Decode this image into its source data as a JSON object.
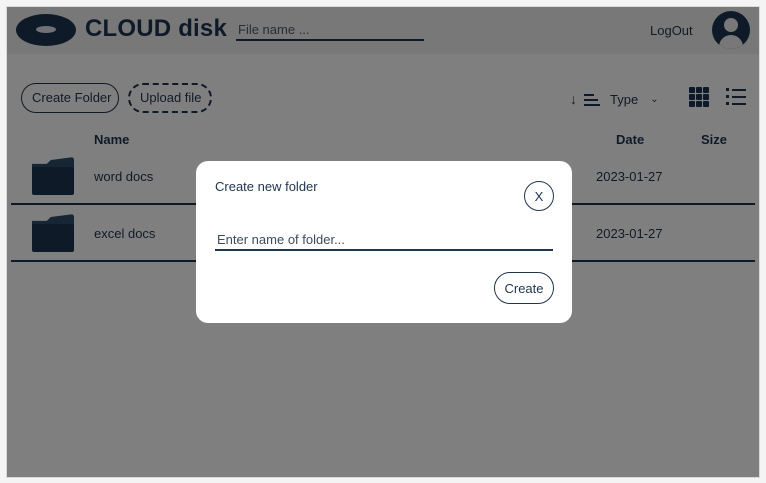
{
  "header": {
    "title": "CLOUD disk",
    "search_placeholder": "File name ...",
    "logout_label": "LogOut"
  },
  "toolbar": {
    "create_folder_label": "Create Folder",
    "upload_file_label": "Upload file",
    "sort_label": "Type"
  },
  "table": {
    "columns": [
      "Name",
      "Date",
      "Size"
    ],
    "rows": [
      {
        "name": "word docs",
        "date": "2023-01-27",
        "size": ""
      },
      {
        "name": "excel docs",
        "date": "2023-01-27",
        "size": ""
      }
    ]
  },
  "modal": {
    "title": "Create new folder",
    "close_label": "X",
    "input_placeholder": "Enter name of folder...",
    "create_label": "Create"
  },
  "colors": {
    "primary": "#1f3550",
    "overlay": "rgba(0,0,0,0.5)"
  },
  "icons": {
    "logo": "cloud-disc-logo-icon",
    "avatar": "user-avatar-icon",
    "sort": "sort-descending-icon",
    "grid": "grid-view-icon",
    "list": "list-view-icon",
    "folder": "folder-icon"
  }
}
